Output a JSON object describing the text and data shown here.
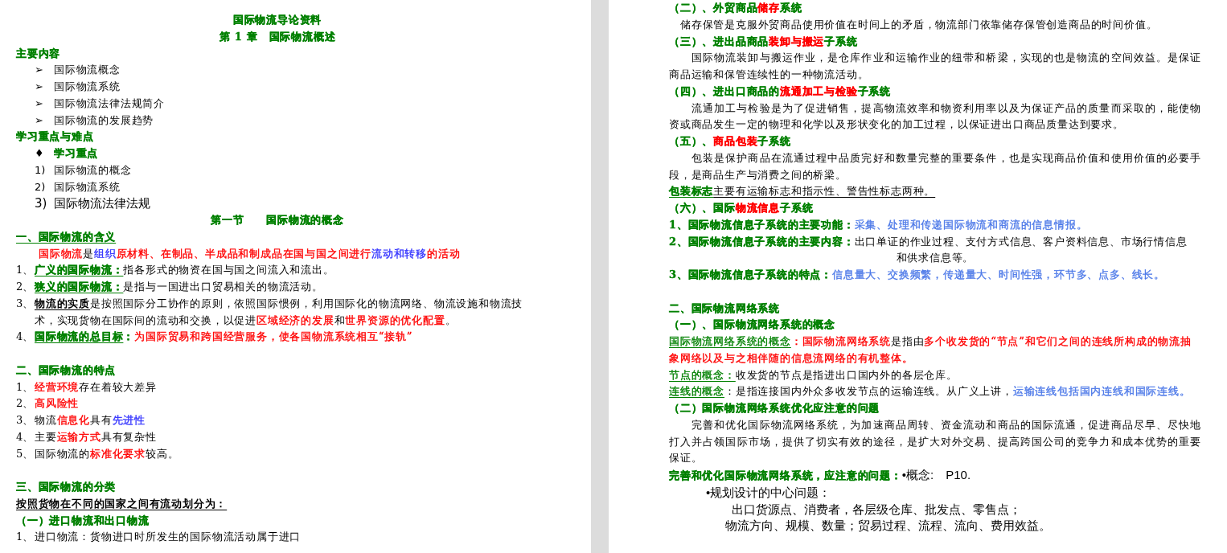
{
  "pages": [
    {
      "paragraphs": [
        {
          "kind": "center",
          "runs": [
            {
              "text": "国际物流导论资料",
              "color": "#008000",
              "bold": true
            }
          ]
        },
        {
          "kind": "center",
          "runs": [
            {
              "text": "第 1 章　国际物流概述",
              "color": "#008000",
              "bold": true
            }
          ]
        },
        {
          "kind": "line",
          "runs": [
            {
              "text": "主要内容",
              "color": "#008000",
              "bold": true
            }
          ]
        },
        {
          "kind": "bullet",
          "marker": "➢",
          "runs": [
            {
              "text": "国际物流概念"
            }
          ]
        },
        {
          "kind": "bullet",
          "marker": "➢",
          "runs": [
            {
              "text": "国际物流系统"
            }
          ]
        },
        {
          "kind": "bullet",
          "marker": "➢",
          "runs": [
            {
              "text": "国际物流法律法规简介"
            }
          ]
        },
        {
          "kind": "bullet",
          "marker": "➢",
          "runs": [
            {
              "text": "国际物流的发展趋势"
            }
          ]
        },
        {
          "kind": "line",
          "runs": [
            {
              "text": "学习重点与难点",
              "color": "#008000",
              "bold": true
            }
          ]
        },
        {
          "kind": "bullet",
          "marker": "♦",
          "runs": [
            {
              "text": "学习重点",
              "color": "#008000",
              "bold": true
            }
          ]
        },
        {
          "kind": "bullet",
          "marker": "1)",
          "runs": [
            {
              "text": "国际物流的概念"
            }
          ]
        },
        {
          "kind": "bullet",
          "marker": "2)",
          "runs": [
            {
              "text": "国际物流系统"
            }
          ]
        },
        {
          "kind": "bullet",
          "marker": "3)",
          "sans": true,
          "runs": [
            {
              "text": "国际物流法律法规"
            }
          ]
        },
        {
          "kind": "center",
          "runs": [
            {
              "text": "第一节　　国际物流的概念",
              "color": "#008000",
              "bold": true
            }
          ]
        },
        {
          "kind": "line",
          "runs": [
            {
              "text": "一、国际物流的含义",
              "color": "#008000",
              "bold": true,
              "underline": true
            }
          ]
        },
        {
          "kind": "para",
          "runs": [
            {
              "text": "国际物流",
              "color": "#ff0000"
            },
            {
              "text": "是"
            },
            {
              "text": "组织",
              "color": "#3333ff"
            },
            {
              "text": "原材料、在制品、半成品和制成品在国与国之间进行",
              "color": "#ff0000"
            },
            {
              "text": "流动和转移",
              "color": "#3333ff"
            },
            {
              "text": "的活动",
              "color": "#ff0000"
            }
          ]
        },
        {
          "kind": "item",
          "marker": "1、",
          "runs": [
            {
              "text": "广义的国际物流：",
              "color": "#008000",
              "bold": true,
              "underline": true
            },
            {
              "text": "指各形式的物资在国与国之间流入和流出。"
            }
          ]
        },
        {
          "kind": "item",
          "marker": "2、",
          "runs": [
            {
              "text": "狭义的国际物流：",
              "color": "#008000",
              "bold": true,
              "underline": true
            },
            {
              "text": "是指与一国进出口贸易相关的物流活动。"
            }
          ]
        },
        {
          "kind": "item",
          "marker": "3、",
          "runs": [
            {
              "text": "物流的实质",
              "bold": true,
              "underline": true
            },
            {
              "text": "是按照国际分工协作的原则，依照国际惯例，利用国际化的物流网络、物流设施和物流技术，实现货物在国际间的流动和交换，以促进"
            },
            {
              "text": "区域经济的发展",
              "color": "#ff0000"
            },
            {
              "text": "和"
            },
            {
              "text": "世界资源的优化配置",
              "color": "#ff0000"
            },
            {
              "text": "。"
            }
          ]
        },
        {
          "kind": "item",
          "marker": "4、",
          "runs": [
            {
              "text": "国际物流的总目标",
              "color": "#008000",
              "bold": true,
              "underline": true
            },
            {
              "text": "：",
              "color": "#008000",
              "bold": true
            },
            {
              "text": "为国际贸易和跨国经营服务，使各国物流系统相互“接轨”",
              "color": "#ff0000"
            }
          ]
        },
        {
          "kind": "line",
          "gap_before": true,
          "runs": [
            {
              "text": "二、国际物流的特点",
              "color": "#008000",
              "bold": true
            }
          ]
        },
        {
          "kind": "item",
          "marker": "1、",
          "runs": [
            {
              "text": "经营环境",
              "color": "#ff0000"
            },
            {
              "text": "存在着较大差异"
            }
          ]
        },
        {
          "kind": "item",
          "marker": "2、",
          "runs": [
            {
              "text": "高风险性",
              "color": "#ff0000"
            }
          ]
        },
        {
          "kind": "item",
          "marker": "3、",
          "runs": [
            {
              "text": "物流"
            },
            {
              "text": "信息化",
              "color": "#ff0000"
            },
            {
              "text": "具有"
            },
            {
              "text": "先进性",
              "color": "#3333ff"
            }
          ]
        },
        {
          "kind": "item",
          "marker": "4、",
          "runs": [
            {
              "text": "主要"
            },
            {
              "text": "运输方式",
              "color": "#ff0000"
            },
            {
              "text": "具有复杂性"
            }
          ]
        },
        {
          "kind": "item",
          "marker": "5、",
          "runs": [
            {
              "text": " 国际物流的"
            },
            {
              "text": "标准化要求",
              "color": "#ff0000"
            },
            {
              "text": "较高。"
            }
          ]
        },
        {
          "kind": "line",
          "gap_before": true,
          "runs": [
            {
              "text": "三、国际物流的分类",
              "color": "#008000",
              "bold": true
            }
          ]
        },
        {
          "kind": "line",
          "runs": [
            {
              "text": "按照货物在不同的国家之间有流动划分为：",
              "bold": true,
              "underline": true
            }
          ]
        },
        {
          "kind": "line",
          "runs": [
            {
              "text": "（一）进口物流和出口物流",
              "color": "#008000",
              "bold": true
            }
          ]
        },
        {
          "kind": "item",
          "marker": "1、",
          "runs": [
            {
              "text": "进口物流：货物进口时所发生的国际物流活动属于进口"
            }
          ]
        }
      ]
    },
    {
      "paragraphs": [
        {
          "kind": "line",
          "runs": [
            {
              "text": "（二）、外贸商品",
              "color": "#008000",
              "bold": true
            },
            {
              "text": "储存",
              "color": "#ff0000",
              "bold": true
            },
            {
              "text": "系统",
              "color": "#008000",
              "bold": true
            }
          ]
        },
        {
          "kind": "lead",
          "runs": [
            {
              "text": "储存保管是克服外贸商品使用价值在时间上的矛盾，物流部门依靠储存保管创造商品的时间价值。"
            }
          ]
        },
        {
          "kind": "line",
          "runs": [
            {
              "text": "（三）、进出品商品",
              "color": "#008000",
              "bold": true
            },
            {
              "text": "装卸与搬运",
              "color": "#ff0000",
              "bold": true
            },
            {
              "text": "子系统",
              "color": "#008000",
              "bold": true
            }
          ]
        },
        {
          "kind": "para",
          "runs": [
            {
              "text": "国际物流装卸与搬运作业，是仓库作业和运输作业的纽带和桥梁，实现的也是物流的空间效益。是保证商品运输和保管连续性的一种物流活动。"
            }
          ]
        },
        {
          "kind": "line",
          "runs": [
            {
              "text": "（四）、进出口商品的",
              "color": "#008000",
              "bold": true
            },
            {
              "text": "流通加工与检验",
              "color": "#ff0000",
              "bold": true
            },
            {
              "text": "子系统",
              "color": "#008000",
              "bold": true
            }
          ]
        },
        {
          "kind": "para",
          "runs": [
            {
              "text": "流通加工与检验是为了促进销售，提高物流效率和物资利用率以及为保证产品的质量而采取的，能使物资或商品发生一定的物理和化学以及形状变化的加工过程，以保证进出口商品质量达到要求。"
            }
          ]
        },
        {
          "kind": "line",
          "runs": [
            {
              "text": "（五）、",
              "color": "#008000",
              "bold": true
            },
            {
              "text": "商品包装",
              "color": "#ff0000",
              "bold": true
            },
            {
              "text": "子系统",
              "color": "#008000",
              "bold": true
            }
          ]
        },
        {
          "kind": "para",
          "runs": [
            {
              "text": "包装是保护商品在流通过程中品质完好和数量完整的重要条件，也是实现商品价值和使用价值的必要手段，是商品生产与消费之间的桥梁。"
            }
          ]
        },
        {
          "kind": "line",
          "runs": [
            {
              "text": "包装标志",
              "color": "#008000",
              "bold": true,
              "underline": true
            },
            {
              "text": "主要有运输标志和指示性、警告性标志两种。",
              "underline": true
            }
          ]
        },
        {
          "kind": "line",
          "runs": [
            {
              "text": "（六）、国际",
              "color": "#008000",
              "bold": true
            },
            {
              "text": "物流信息",
              "color": "#ff0000",
              "bold": true
            },
            {
              "text": "子系统",
              "color": "#008000",
              "bold": true
            }
          ]
        },
        {
          "kind": "line",
          "runs": [
            {
              "text": "1、国际物流信息子系统的主要功能：",
              "color": "#008000",
              "bold": true
            },
            {
              "text": "采集、处理和传递国际物流和商流的信息情报。",
              "color": "#4d79e8"
            }
          ]
        },
        {
          "kind": "line",
          "runs": [
            {
              "text": "2、国际物流信息子系统的主要内容：",
              "color": "#008000",
              "bold": true
            },
            {
              "text": "出口单证的作业过程、支付方式信息、客户资料信息、市场行情信息"
            }
          ]
        },
        {
          "kind": "center",
          "runs": [
            {
              "text": "和供求信息等。"
            }
          ]
        },
        {
          "kind": "line",
          "runs": [
            {
              "text": "3、国际物流信息子系统的特点：",
              "color": "#008000",
              "bold": true
            },
            {
              "text": "信息量大、交换频繁，传递量大、时间性强，环节多、点多、线长。",
              "color": "#4d79e8"
            }
          ]
        },
        {
          "kind": "line",
          "gap_before": true,
          "runs": [
            {
              "text": "二、国际物流网络系统",
              "color": "#008000",
              "bold": true
            }
          ]
        },
        {
          "kind": "line",
          "runs": [
            {
              "text": "（一）、国际物流网络系统的概念",
              "color": "#008000",
              "bold": true
            }
          ]
        },
        {
          "kind": "line",
          "runs": [
            {
              "text": "国际物流网络系统的概念",
              "color": "#008000",
              "underline": true
            },
            {
              "text": "：国际物流网络系统",
              "color": "#ff0000"
            },
            {
              "text": "是指由"
            },
            {
              "text": "多个收发货的“节点”和它们之间的连线所构成的物流抽象网络以及与之相伴随的信息流网络的有机整体。",
              "color": "#ff0000"
            }
          ]
        },
        {
          "kind": "line",
          "runs": [
            {
              "text": "节点的概念：",
              "color": "#008000",
              "underline": true
            },
            {
              "text": "收发货的节点是指进出口国内外的各层仓库。"
            }
          ]
        },
        {
          "kind": "line",
          "runs": [
            {
              "text": "连线的概念",
              "color": "#008000",
              "underline": true
            },
            {
              "text": "：是指连接国内外众多收发节点的运输连线。从广义上讲，"
            },
            {
              "text": "运输连线包括国内连线和国际连线。",
              "color": "#4d79e8"
            }
          ]
        },
        {
          "kind": "line",
          "runs": [
            {
              "text": "（二）国际物流网络系统优化应注意的问题",
              "color": "#008000",
              "bold": true
            }
          ]
        },
        {
          "kind": "para",
          "runs": [
            {
              "text": "完善和优化国际物流网络系统，为加速商品周转、资金流动和商品的国际流通，促进商品尽早、尽快地打入并占领国际市场，提供了切实有效的途径，是扩大对外交易、提高跨国公司的竞争力和成本优势的重要保证。"
            }
          ]
        },
        {
          "kind": "line",
          "runs": [
            {
              "text": "完善和优化国际物流网络系统，应注意的问题：",
              "color": "#008000",
              "bold": true
            },
            {
              "text": "•概念:　P10.",
              "sans": true
            }
          ]
        },
        {
          "kind": "note1",
          "sans": true,
          "runs": [
            {
              "text": "•规划设计的中心问题："
            }
          ]
        },
        {
          "kind": "note2",
          "sans": true,
          "runs": [
            {
              "text": "出口货源点、消费者，各层级仓库、批发点、零售点；"
            }
          ]
        },
        {
          "kind": "note3",
          "sans": true,
          "runs": [
            {
              "text": "物流方向、规模、数量；贸易过程、流程、流向、费用效益。"
            }
          ]
        }
      ]
    }
  ]
}
